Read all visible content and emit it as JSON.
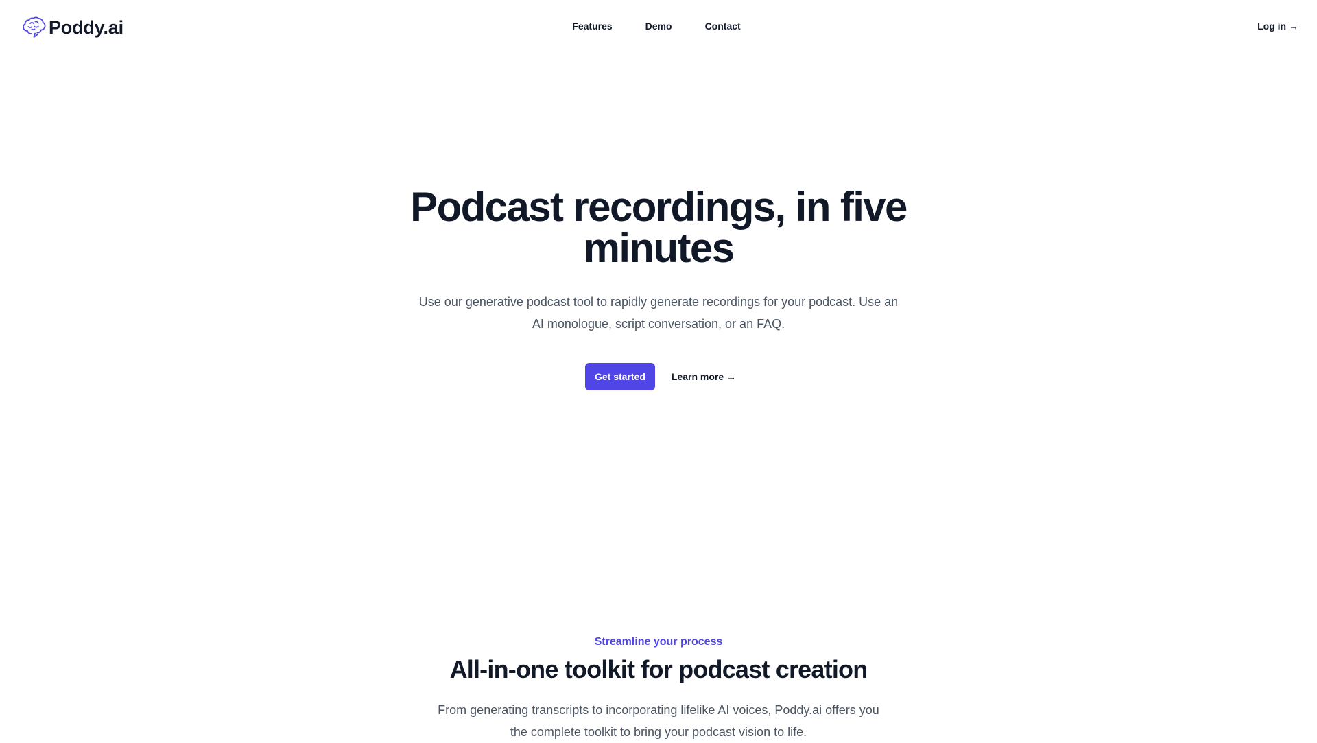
{
  "brand": {
    "name": "Poddy.ai",
    "accent": "#4f46e5",
    "icon": "brain-icon"
  },
  "nav": {
    "links": [
      "Features",
      "Demo",
      "Contact"
    ],
    "login": "Log in →"
  },
  "hero": {
    "title": "Podcast recordings, in five minutes",
    "subtitle": "Use our generative podcast tool to rapidly generate recordings for your podcast. Use an AI monologue, script conversation, or an FAQ.",
    "primary_cta": "Get started",
    "secondary_cta": "Learn more →"
  },
  "features": {
    "eyebrow": "Streamline your process",
    "title": "All-in-one toolkit for podcast creation",
    "description": "From generating transcripts to incorporating lifelike AI voices, Poddy.ai offers you the complete toolkit to bring your podcast vision to life."
  }
}
